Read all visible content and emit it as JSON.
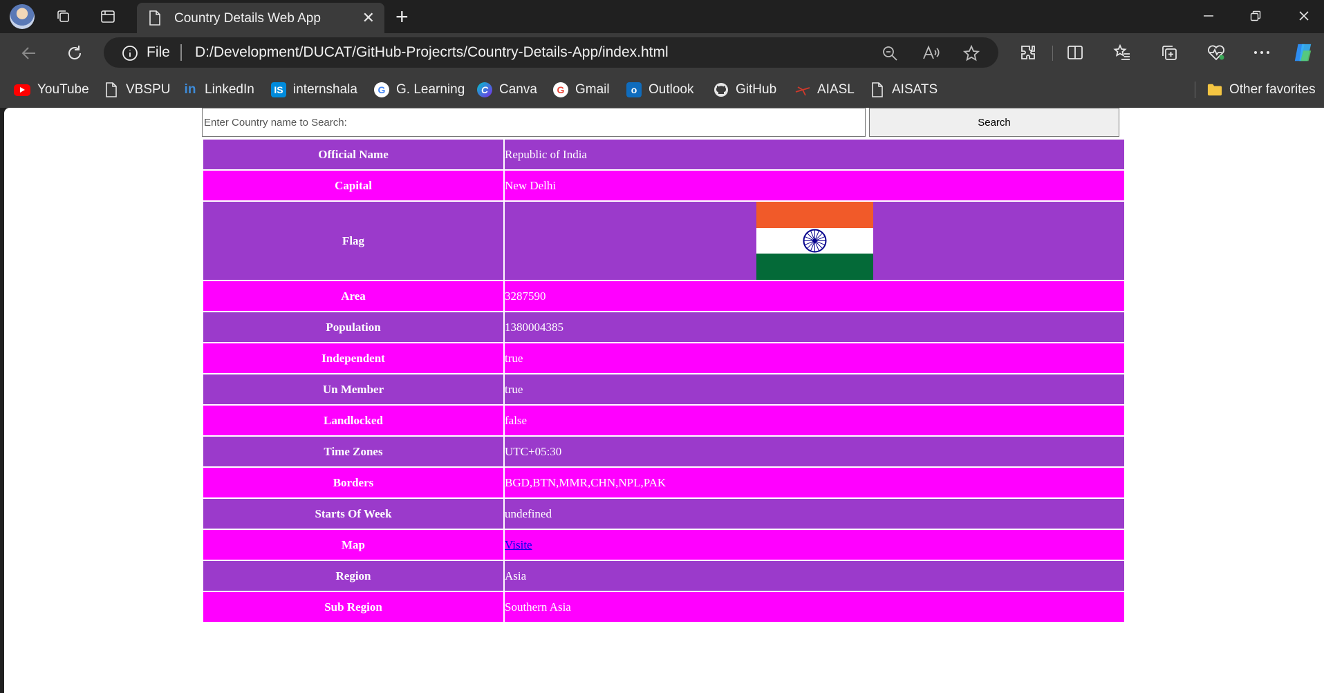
{
  "browser": {
    "tab_title": "Country Details Web App",
    "scheme": "File",
    "url": "D:/Development/DUCAT/GitHub-Projecrts/Country-Details-App/index.html"
  },
  "bookmarks": [
    {
      "label": "YouTube",
      "icon": "youtube-icon",
      "color": "#ff0000"
    },
    {
      "label": "VBSPU",
      "icon": "page-icon"
    },
    {
      "label": "LinkedIn",
      "icon": "linkedin-icon",
      "color": "#0a66c2"
    },
    {
      "label": "internshala",
      "icon": "internshala-icon",
      "color": "#008bdc"
    },
    {
      "label": "G. Learning",
      "icon": "google-icon"
    },
    {
      "label": "Canva",
      "icon": "canva-icon",
      "color": "#7d2ae8"
    },
    {
      "label": "Gmail",
      "icon": "google-icon"
    },
    {
      "label": "Outlook",
      "icon": "outlook-icon",
      "color": "#0f6cbd"
    },
    {
      "label": "GitHub",
      "icon": "github-icon"
    },
    {
      "label": "AIASL",
      "icon": "aiasl-icon",
      "color": "#d0392b"
    },
    {
      "label": "AISATS",
      "icon": "page-icon"
    }
  ],
  "other_favorites": "Other favorites",
  "search": {
    "placeholder": "Enter Country name to Search:",
    "button_label": "Search"
  },
  "details": {
    "official_name": {
      "label": "Official Name",
      "value": "Republic of India"
    },
    "capital": {
      "label": "Capital",
      "value": "New Delhi"
    },
    "flag": {
      "label": "Flag"
    },
    "area": {
      "label": "Area",
      "value": "3287590"
    },
    "population": {
      "label": "Population",
      "value": "1380004385"
    },
    "independent": {
      "label": "Independent",
      "value": "true"
    },
    "un_member": {
      "label": "Un Member",
      "value": "true"
    },
    "landlocked": {
      "label": "Landlocked",
      "value": "false"
    },
    "time_zones": {
      "label": "Time Zones",
      "value": "UTC+05:30"
    },
    "borders": {
      "label": "Borders",
      "value": "BGD,BTN,MMR,CHN,NPL,PAK"
    },
    "starts_of_week": {
      "label": "Starts Of Week",
      "value": "undefined"
    },
    "map": {
      "label": "Map",
      "value": "Visite"
    },
    "region": {
      "label": "Region",
      "value": "Asia"
    },
    "sub_region": {
      "label": "Sub Region",
      "value": "Southern Asia"
    }
  },
  "colors": {
    "row_purple": "#9b3acb",
    "row_magenta": "#ff00ff",
    "flag_saffron": "#f15a29",
    "flag_green": "#046a38",
    "flag_chakra": "#06038d"
  }
}
